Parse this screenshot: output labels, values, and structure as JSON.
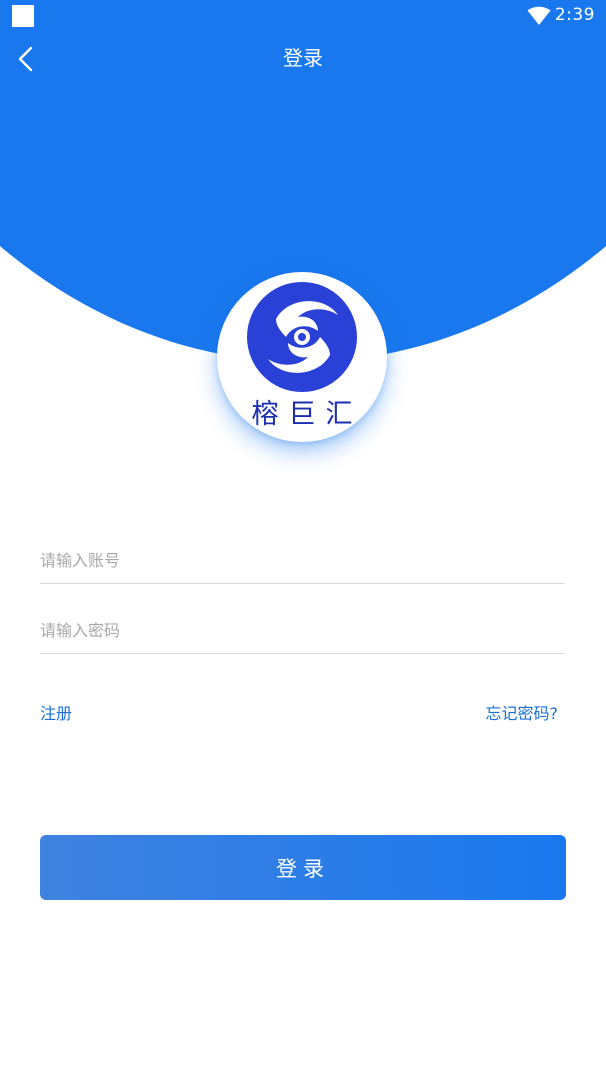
{
  "status_bar": {
    "time": "2:39"
  },
  "nav": {
    "title": "登录",
    "back_icon": "chevron-left-icon"
  },
  "logo": {
    "text": "榕巨汇"
  },
  "form": {
    "account_placeholder": "请输入账号",
    "account_value": "",
    "password_placeholder": "请输入密码",
    "password_value": ""
  },
  "links": {
    "register": "注册",
    "forgot_password": "忘记密码?"
  },
  "login_button": {
    "label": "登录"
  },
  "colors": {
    "primary": "#1a78ee",
    "link": "#1a6fd8",
    "logo_blue": "#1b2fb0"
  }
}
